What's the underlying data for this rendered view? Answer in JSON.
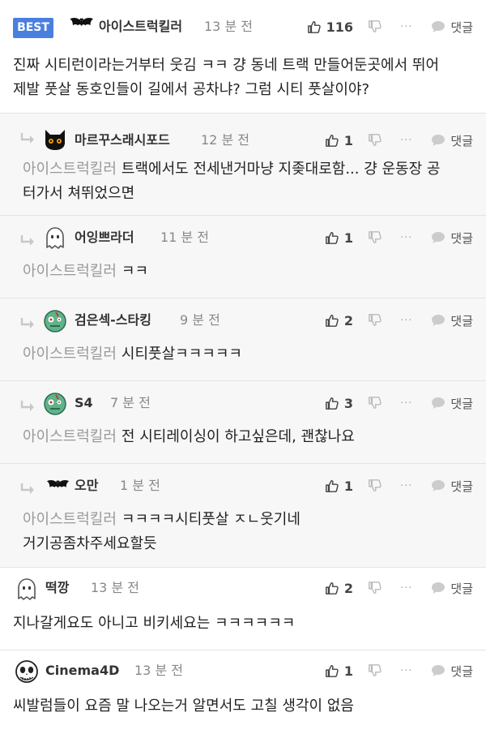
{
  "best_label": "BEST",
  "reply_label": "댓글",
  "more_label": "···",
  "comments": [
    {
      "nick": "아이스트럭킬러",
      "time": "13 분 전",
      "likes": "116",
      "mention": "",
      "text": "진짜 시티런이라는거부터 웃김 ㅋㅋ 걍 동네 트랙 만들어둔곳에서 뛰어",
      "text2": "제발 풋살 동호인들이 길에서 공차냐? 그럼 시티 풋살이야?",
      "avatar": "bat-icon"
    },
    {
      "nick": "마르꾸스래시포드",
      "time": "12 분 전",
      "likes": "1",
      "mention": "아이스트럭킬러",
      "text": "트랙에서도 전세낸거마냥 지좆대로함... 걍 운동장 공",
      "text2": "터가서 쳐뛰었으면",
      "avatar": "black-cat-icon"
    },
    {
      "nick": "어잉쁘라더",
      "time": "11 분 전",
      "likes": "1",
      "mention": "아이스트럭킬러",
      "text": "ㅋㅋ",
      "text2": "",
      "avatar": "ghost-icon"
    },
    {
      "nick": "검은섹-스타킹",
      "time": "9 분 전",
      "likes": "2",
      "mention": "아이스트럭킬러",
      "text": "시티풋살ㅋㅋㅋㅋㅋ",
      "text2": "",
      "avatar": "zombie-icon"
    },
    {
      "nick": "S4",
      "time": "7 분 전",
      "likes": "3",
      "mention": "아이스트럭킬러",
      "text": "전 시티레이싱이 하고싶은데, 괜찮나요",
      "text2": "",
      "avatar": "zombie-icon"
    },
    {
      "nick": "오만",
      "time": "1 분 전",
      "likes": "1",
      "mention": "아이스트럭킬러",
      "text": "ㅋㅋㅋㅋ시티풋살 ㅈㄴ웃기네",
      "text2": "거기공좀차주세요할듯",
      "avatar": "bat-icon"
    },
    {
      "nick": "떡깡",
      "time": "13 분 전",
      "likes": "2",
      "mention": "",
      "text": "지나갈게요도 아니고 비키세요는 ㅋㅋㅋㅋㅋㅋ",
      "text2": "",
      "avatar": "ghost-icon"
    },
    {
      "nick": "Cinema4D",
      "time": "13 분 전",
      "likes": "1",
      "mention": "",
      "text": "씨발럼들이 요즘 말 나오는거 알면서도 고칠 생각이 없음",
      "text2": "",
      "avatar": "skull-icon"
    }
  ]
}
